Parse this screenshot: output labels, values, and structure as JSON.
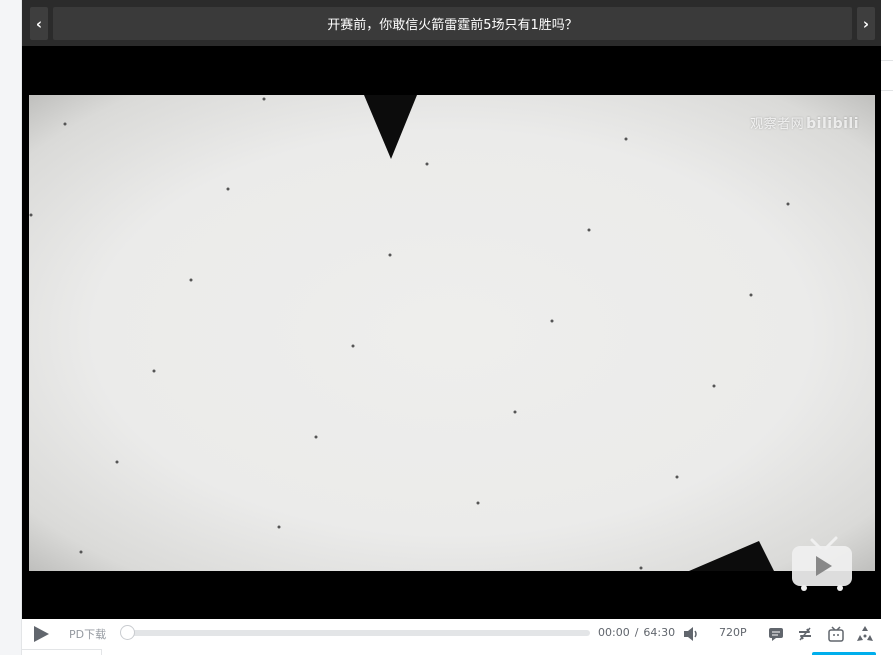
{
  "header": {
    "prev_glyph": "‹",
    "next_glyph": "›",
    "title": "开赛前，你敢信火箭雷霆前5场只有1胜吗？"
  },
  "video": {
    "watermark_text": "观察者网",
    "watermark_logo": "bilibili"
  },
  "controls": {
    "download_label": "PD下载",
    "progress": 0,
    "current_time": "00:00",
    "separator": "/",
    "duration": "64:30",
    "quality": "720P"
  },
  "icons": {
    "play": "play-icon",
    "volume": "volume-icon",
    "danmaku": "danmaku-icon",
    "loop": "loop-icon",
    "tv": "bilibili-tv-icon",
    "fullscreen": "fullscreen-icon"
  },
  "colors": {
    "titlebar": "#2b2b2b",
    "accent": "#00aeec",
    "frame_bg": "#ebebea"
  }
}
